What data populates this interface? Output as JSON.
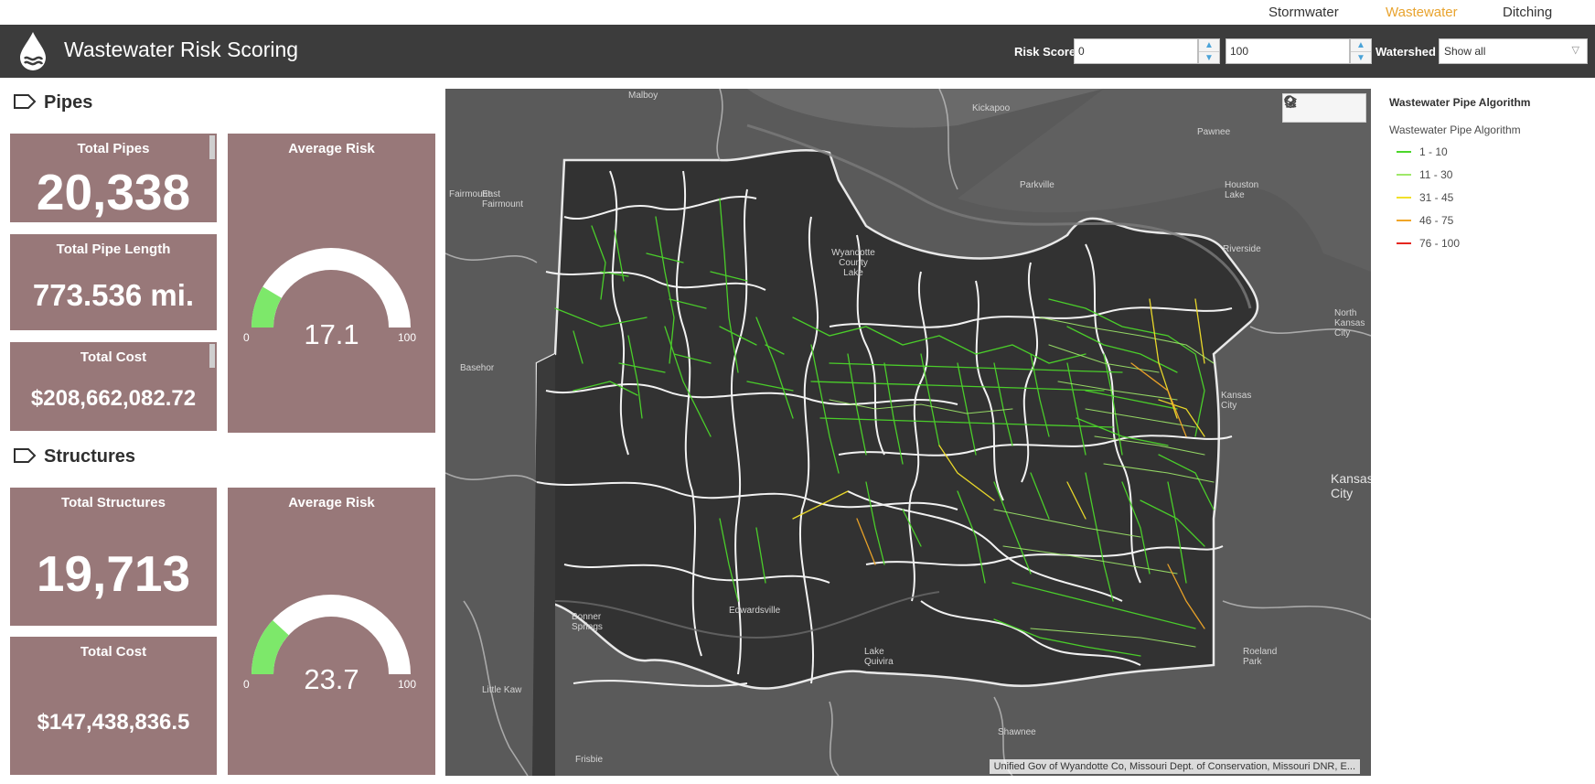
{
  "nav": {
    "items": [
      "Stormwater",
      "Wastewater",
      "Ditching"
    ],
    "active": "Wastewater"
  },
  "header": {
    "title": "Wastewater Risk Scoring",
    "risk_label": "Risk Score",
    "risk_min": "0",
    "risk_max": "100",
    "watershed_label": "Watershed",
    "watershed_value": "Show all"
  },
  "pipes": {
    "section_title": "Pipes",
    "total_pipes_label": "Total Pipes",
    "total_pipes": "20,338",
    "length_label": "Total Pipe Length",
    "length": "773.536 mi.",
    "cost_label": "Total Cost",
    "cost": "$208,662,082.72",
    "avg_risk_label": "Average Risk",
    "avg_risk_display": "17.1",
    "avg_risk": 17.1,
    "gauge_min": "0",
    "gauge_max": "100"
  },
  "structures": {
    "section_title": "Structures",
    "total_label": "Total Structures",
    "total": "19,713",
    "cost_label": "Total Cost",
    "cost": "$147,438,836.5",
    "avg_risk_label": "Average Risk",
    "avg_risk_display": "23.7",
    "avg_risk": 23.7,
    "gauge_min": "0",
    "gauge_max": "100"
  },
  "map": {
    "attribution": "Unified Gov of Wyandotte Co, Missouri Dept. of Conservation, Missouri DNR, E...",
    "place_labels": [
      "Malboy",
      "Kickapoo",
      "Pawnee",
      "Fairmount",
      "East Fairmount",
      "Parkville",
      "Houston Lake",
      "Riverside",
      "Wyandotte County Lake",
      "North Kansas City",
      "Basehor",
      "Kansas City",
      "Kansas City",
      "Bonner Springs",
      "Edwardsville",
      "Lake Quivira",
      "Roeland Park",
      "Little Kaw",
      "Shawnee",
      "Frisbie"
    ],
    "tools": [
      "search-icon",
      "home-icon",
      "layers-icon"
    ]
  },
  "legend": {
    "title": "Wastewater Pipe Algorithm",
    "layer": "Wastewater Pipe Algorithm",
    "items": [
      {
        "label": "1 - 10",
        "color": "#4cd62a"
      },
      {
        "label": "11 - 30",
        "color": "#9fe86a"
      },
      {
        "label": "31 - 45",
        "color": "#f2e02a"
      },
      {
        "label": "46 - 75",
        "color": "#f0a628"
      },
      {
        "label": "76 - 100",
        "color": "#e5271f"
      }
    ]
  },
  "colors": {
    "card": "#987879",
    "header": "#3c3c3c",
    "gauge_fill": "#7de86a",
    "nav_active": "#e8a32e"
  }
}
